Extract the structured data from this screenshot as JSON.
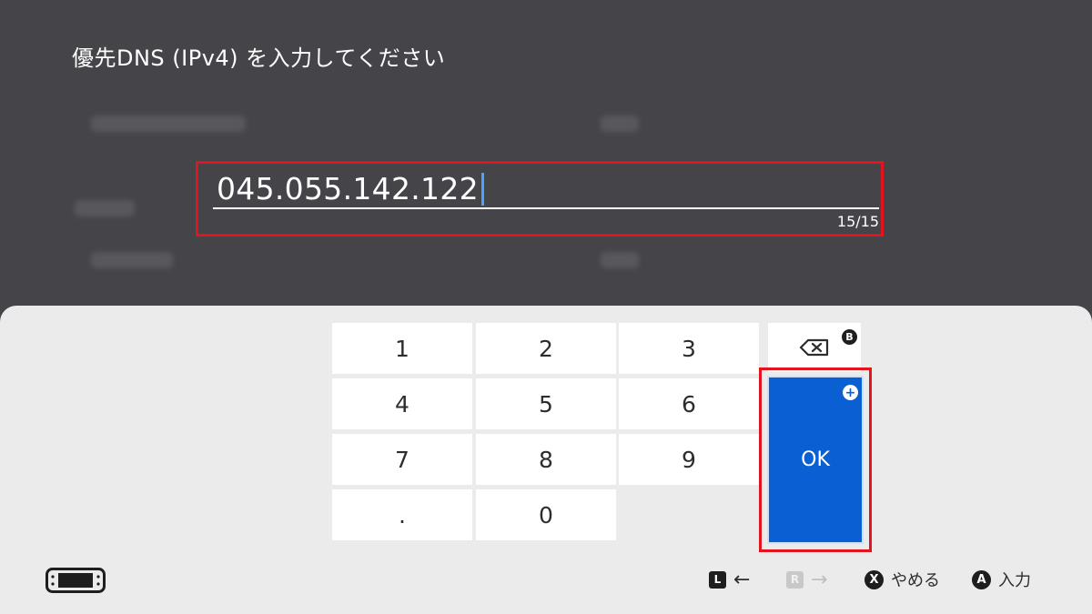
{
  "title": "優先DNS (IPv4) を入力してください",
  "input": {
    "value": "045.055.142.122",
    "counter": "15/15"
  },
  "keypad": {
    "keys": [
      "1",
      "2",
      "3",
      "4",
      "5",
      "6",
      "7",
      "8",
      "9",
      ".",
      "0"
    ],
    "backspace_badge": "B",
    "ok_label": "OK",
    "ok_badge": "+"
  },
  "footer": {
    "l_button": "L",
    "r_button": "R",
    "cancel_button": "X",
    "cancel_label": "やめる",
    "confirm_button": "A",
    "confirm_label": "入力"
  },
  "colors": {
    "accent": "#0a5fd3",
    "highlight": "#e3141d",
    "background": "#454549",
    "panel": "#ebebeb"
  }
}
